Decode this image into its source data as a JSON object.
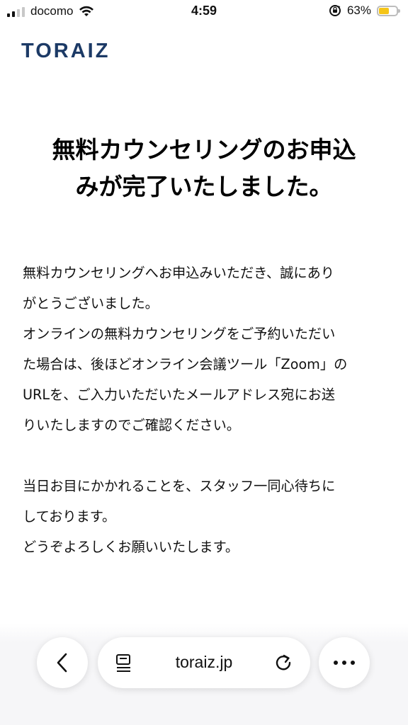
{
  "status_bar": {
    "carrier": "docomo",
    "time": "4:59",
    "battery_percent": "63%",
    "battery_level": 0.63,
    "battery_color": "#f5c518",
    "icons": [
      "signal-icon",
      "wifi-icon",
      "rotation-lock-icon",
      "battery-icon"
    ]
  },
  "header": {
    "logo_text": "TORAIZ",
    "logo_color": "#1c3a66"
  },
  "main": {
    "title_line1": "無料カウンセリングのお申込",
    "title_line2": "みが完了いたしました。",
    "paragraph1": [
      "無料カウンセリングへお申込みいただき、誠にあり",
      "がとうございました。",
      "オンラインの無料カウンセリングをご予約いただい",
      "た場合は、後ほどオンライン会議ツール「Zoom」の",
      "URLを、ご入力いただいたメールアドレス宛にお送",
      "りいたしますのでご確認ください。"
    ],
    "paragraph2": [
      "当日お目にかかれることを、スタッフ一同心待ちに",
      "しております。",
      "どうぞよろしくお願いいたします。"
    ]
  },
  "browser_bar": {
    "url": "toraiz.jp",
    "icons": [
      "back-icon",
      "reader-mode-icon",
      "reload-icon",
      "more-icon"
    ]
  }
}
